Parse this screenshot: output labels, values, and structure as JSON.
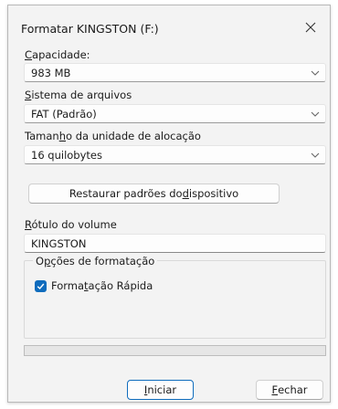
{
  "window": {
    "title": "Formatar KINGSTON (F:)",
    "close_icon": "close-icon"
  },
  "capacity": {
    "label_mnemonic": "C",
    "label_rest": "apacidade:",
    "value": "983 MB"
  },
  "filesystem": {
    "label_mnemonic": "S",
    "label_rest": "istema de arquivos",
    "value": "FAT (Padrão)"
  },
  "allocation": {
    "label_pre": "Taman",
    "label_mnemonic": "h",
    "label_post": "o da unidade de alocação",
    "value": "16 quilobytes"
  },
  "restore_button": {
    "label_pre": "Restaurar padrões do ",
    "label_mnemonic": "d",
    "label_post": "ispositivo"
  },
  "volume": {
    "label_mnemonic": "R",
    "label_rest": "ótulo do volume",
    "value": "KINGSTON"
  },
  "format_options": {
    "title_pre": "O",
    "title_mnemonic": "p",
    "title_post": "ções de formatação",
    "quick_format": {
      "label_pre": "Forma",
      "label_mnemonic": "t",
      "label_post": "ação Rápida",
      "checked": true
    }
  },
  "progress": {
    "value_percent": 0
  },
  "buttons": {
    "start_mnemonic": "I",
    "start_rest": "niciar",
    "close_mnemonic": "F",
    "close_rest": "echar"
  },
  "colors": {
    "accent": "#0f6cbd",
    "dialog_bg": "#f3f3f3"
  }
}
